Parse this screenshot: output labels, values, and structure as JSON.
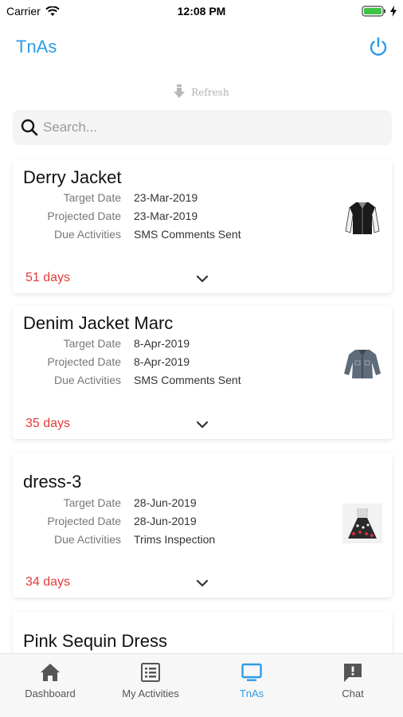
{
  "status_bar": {
    "carrier": "Carrier",
    "time": "12:08 PM"
  },
  "header": {
    "title": "TnAs",
    "accent_color": "#2d9be6"
  },
  "refresh": {
    "label": "Refresh"
  },
  "search": {
    "placeholder": "Search..."
  },
  "labels": {
    "target_date": "Target Date",
    "projected_date": "Projected Date",
    "due_activities": "Due Activities"
  },
  "cards": [
    {
      "title": "Derry Jacket",
      "target_date": "23-Mar-2019",
      "projected_date": "23-Mar-2019",
      "due_activities": "SMS Comments Sent",
      "days": "51 days",
      "thumbnail": "black-jacket-image"
    },
    {
      "title": "Denim Jacket Marc",
      "target_date": "8-Apr-2019",
      "projected_date": "8-Apr-2019",
      "due_activities": "SMS Comments Sent",
      "days": "35 days",
      "thumbnail": "denim-jacket-image"
    },
    {
      "title": "dress-3",
      "target_date": "28-Jun-2019",
      "projected_date": "28-Jun-2019",
      "due_activities": "Trims Inspection",
      "days": "34 days",
      "thumbnail": "dress-image"
    },
    {
      "title": "Pink Sequin Dress"
    }
  ],
  "days_color": "#e43a3a",
  "tabbar": {
    "tabs": [
      {
        "label": "Dashboard",
        "icon": "home-icon"
      },
      {
        "label": "My Activities",
        "icon": "list-icon"
      },
      {
        "label": "TnAs",
        "icon": "monitor-icon",
        "active": true
      },
      {
        "label": "Chat",
        "icon": "chat-icon"
      }
    ]
  }
}
